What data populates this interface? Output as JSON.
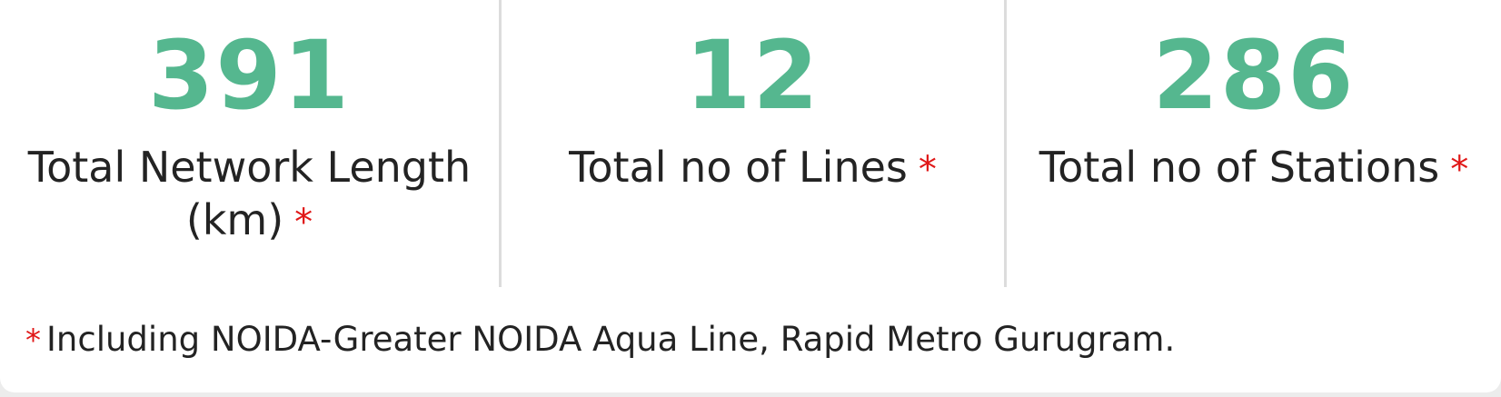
{
  "stats": [
    {
      "value": "391",
      "label_line1": "Total Network Length",
      "label_line2": "(km)",
      "marker": "*"
    },
    {
      "value": "12",
      "label": "Total no of Lines",
      "marker": "*"
    },
    {
      "value": "286",
      "label": "Total no of Stations",
      "marker": "*"
    }
  ],
  "footnote": {
    "marker": "*",
    "text": "Including NOIDA-Greater NOIDA Aqua Line, Rapid Metro Gurugram."
  },
  "colors": {
    "value_green": "#55b78f",
    "marker_red": "#e01818",
    "text_dark": "#232323",
    "divider": "#dcdcdc"
  }
}
